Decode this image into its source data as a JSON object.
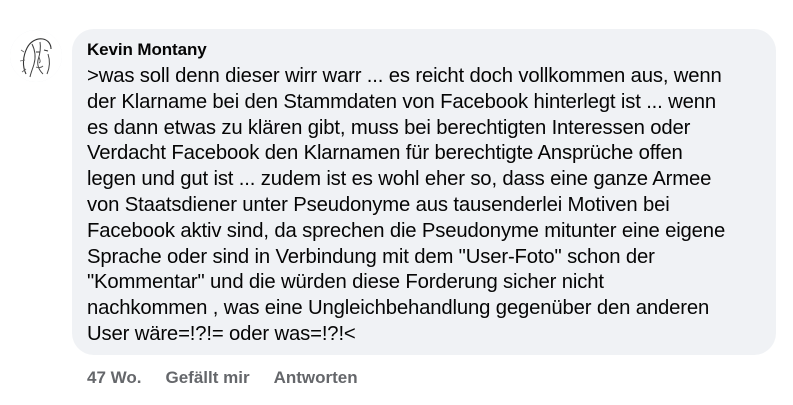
{
  "comment": {
    "author": "Kevin Montany",
    "avatar_icon": "sketch-portrait-avatar",
    "text": ">was soll denn dieser wirr warr ... es reicht doch vollkommen aus, wenn\nder Klarname bei den Stammdaten von Facebook hinterlegt ist ... wenn\nes dann etwas zu klären gibt, muss bei berechtigten Interessen oder\nVerdacht  Facebook den Klarnamen für berechtigte Ansprüche offen\nlegen und gut ist ... zudem ist es wohl eher so, dass eine ganze Armee\nvon Staatsdiener unter Pseudonyme aus tausenderlei Motiven bei\nFacebook aktiv sind, da sprechen die Pseudonyme mitunter eine eigene\nSprache oder sind in Verbindung mit dem \"User-Foto\"  schon der\n\"Kommentar\" und die würden diese Forderung sicher nicht\nnachkommen , was eine Ungleichbehandlung gegenüber den anderen\nUser wäre=!?!= oder was=!?!<"
  },
  "actions": {
    "timestamp": "47 Wo.",
    "like_label": "Gefällt mir",
    "reply_label": "Antworten"
  },
  "colors": {
    "bubble_background": "#f0f2f5",
    "text": "#050505",
    "secondary_text": "#65676b"
  }
}
